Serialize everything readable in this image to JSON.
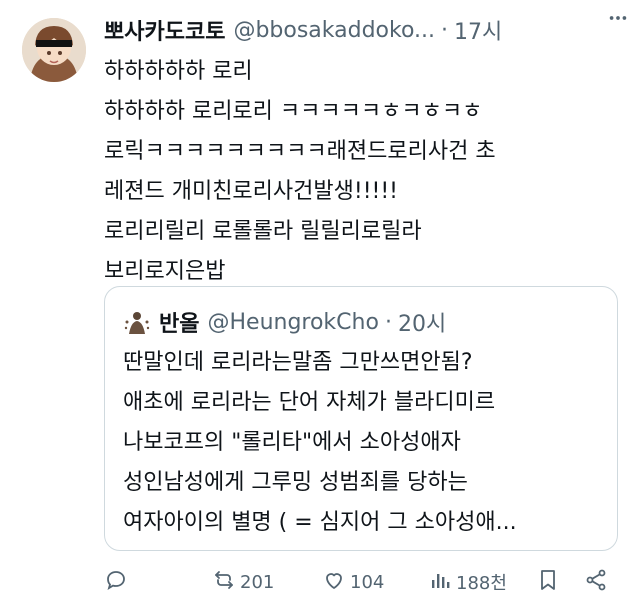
{
  "tweet": {
    "display_name": "뽀사카도코토",
    "handle": "@bbosakaddoko...",
    "separator": "·",
    "time": "17시",
    "lines": [
      "하하하하하 로리",
      "하하하하 로리로리 ㅋㅋㅋㅋㅋㅎㅋㅎㅋㅎ",
      "로릭ㅋㅋㅋㅋㅋㅋㅋㅋㅋ래젼드로리사건 초",
      "레젼드 개미친로리사건발생!!!!!",
      "로리리릴리 로롤롤라 릴릴리로릴라",
      "보리로지은밥"
    ]
  },
  "quote": {
    "display_name": "반올",
    "handle": "@HeungrokCho",
    "separator": "·",
    "time": "20시",
    "lines": [
      "딴말인데 로리라는말좀 그만쓰면안됨?",
      "애초에 로리라는 단어 자체가 블라디미르",
      "나보코프의 \"롤리타\"에서 소아성애자",
      "성인남성에게 그루밍 성범죄를 당하는",
      "여자아이의 별명 ( = 심지어 그 소아성애..."
    ]
  },
  "actions": {
    "retweets": "201",
    "likes": "104",
    "views": "188천"
  },
  "icons": [
    "avatar",
    "more-icon",
    "quote-avatar",
    "reply-icon",
    "retweet-icon",
    "like-icon",
    "views-icon",
    "bookmark-icon",
    "share-icon"
  ]
}
